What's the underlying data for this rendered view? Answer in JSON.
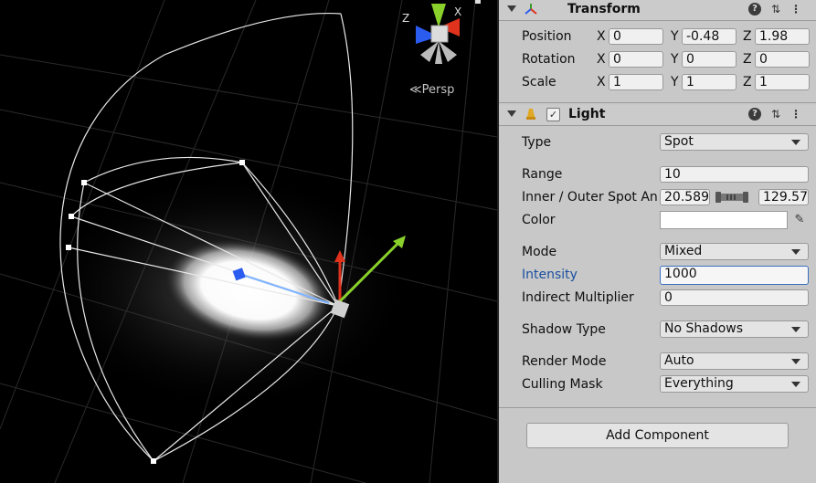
{
  "scene": {
    "persp_label": "Persp",
    "gizmo_axes": {
      "x": "X",
      "y": "Y",
      "z": "Z"
    }
  },
  "transform": {
    "title": "Transform",
    "rows": [
      {
        "label": "Position",
        "x": "0",
        "y": "-0.48",
        "z": "1.98"
      },
      {
        "label": "Rotation",
        "x": "0",
        "y": "0",
        "z": "0"
      },
      {
        "label": "Scale",
        "x": "1",
        "y": "1",
        "z": "1"
      }
    ]
  },
  "light": {
    "title": "Light",
    "enabled": true,
    "type": {
      "label": "Type",
      "value": "Spot"
    },
    "range": {
      "label": "Range",
      "value": "10"
    },
    "spot_angle": {
      "label": "Inner / Outer Spot An",
      "inner": "20.589",
      "outer": "129.57"
    },
    "color": {
      "label": "Color",
      "value": "#ffffff"
    },
    "mode": {
      "label": "Mode",
      "value": "Mixed"
    },
    "intensity": {
      "label": "Intensity",
      "value": "1000"
    },
    "indirect": {
      "label": "Indirect Multiplier",
      "value": "0"
    },
    "shadow": {
      "label": "Shadow Type",
      "value": "No Shadows"
    },
    "render_mode": {
      "label": "Render Mode",
      "value": "Auto"
    },
    "culling": {
      "label": "Culling Mask",
      "value": "Everything"
    }
  },
  "add_component": "Add Component",
  "colors": {
    "intensity_label": "#1a4fa0",
    "x_axis": "#e0321c",
    "y_axis": "#8ad12b",
    "z_axis": "#2b5cf0"
  }
}
